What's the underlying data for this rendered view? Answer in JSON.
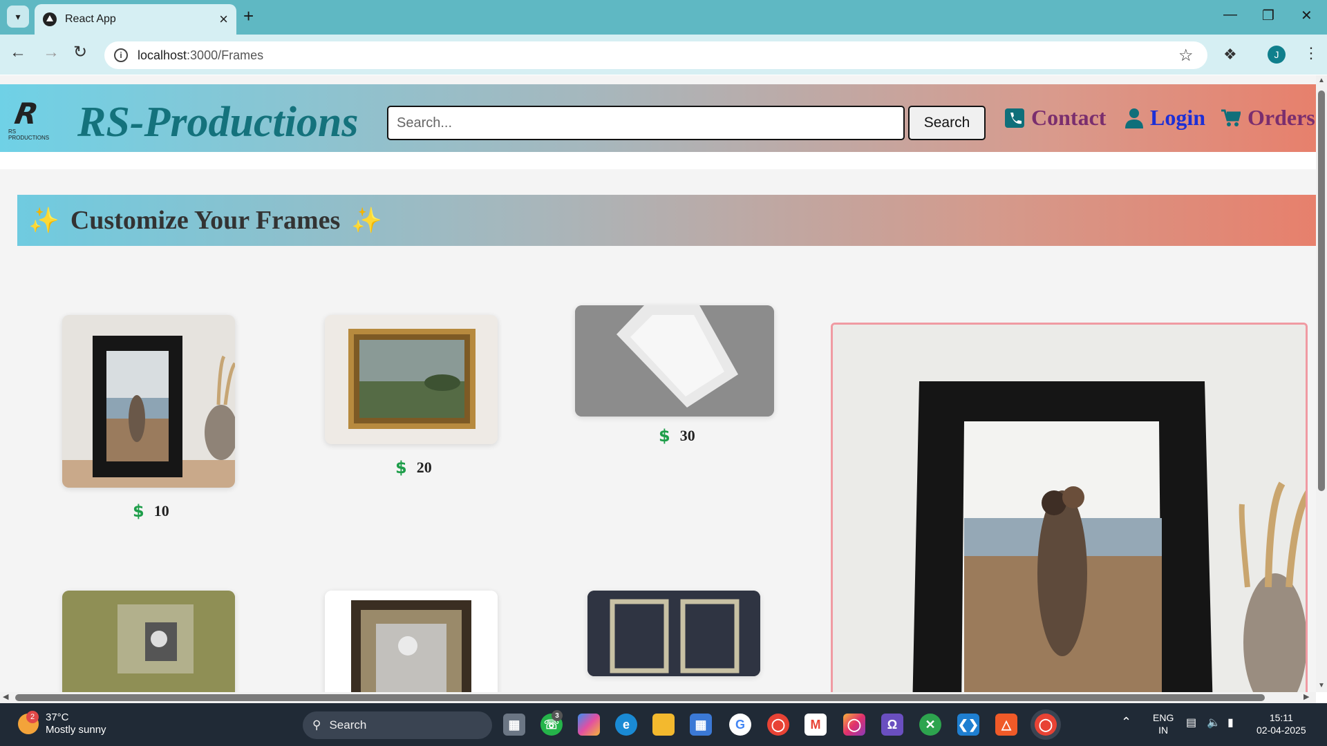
{
  "browser": {
    "tab_title": "React App",
    "url_host": "localhost",
    "url_path": ":3000/Frames",
    "profile_initial": "J"
  },
  "site": {
    "logo_sub": "RS PRODUCTIONS",
    "brand": "RS-Productions",
    "search_placeholder": "Search...",
    "search_button": "Search",
    "nav": {
      "contact": "Contact",
      "login": "Login",
      "orders": "Orders"
    },
    "colors": {
      "brand_teal": "#14727c",
      "contact": "#7a2e6e",
      "login": "#1d2fd6",
      "orders": "#7a2e6e",
      "price_icon": "#1e9e4a",
      "preview_border": "#f09aa2"
    }
  },
  "banner": {
    "spark_left": "✨",
    "title": "Customize Your Frames",
    "spark_right": "✨"
  },
  "frames": [
    {
      "price": "10"
    },
    {
      "price": "20"
    },
    {
      "price": "30"
    }
  ],
  "taskbar": {
    "weather_badge": "2",
    "temperature": "37°C",
    "condition": "Mostly sunny",
    "search_label": "Search",
    "whatsapp_badge": "3",
    "lang_top": "ENG",
    "lang_bottom": "IN",
    "time": "15:11",
    "date": "02-04-2025"
  }
}
